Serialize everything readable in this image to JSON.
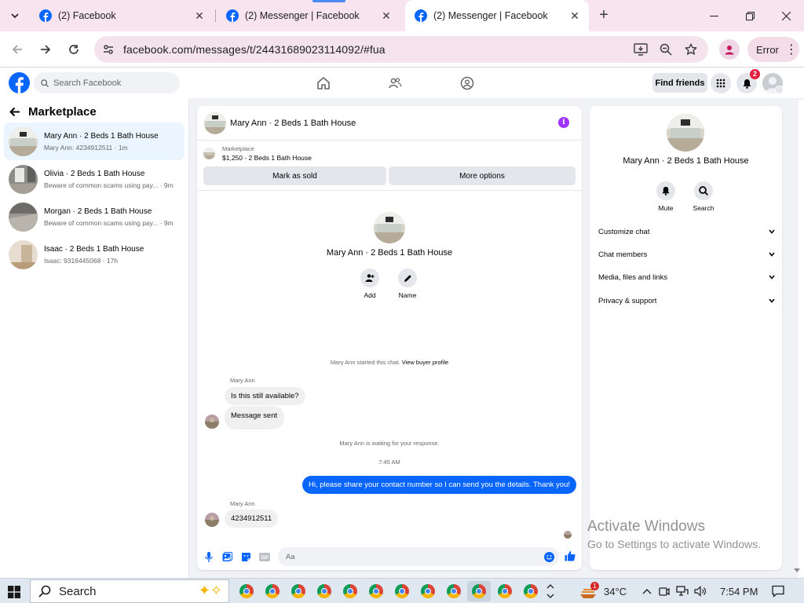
{
  "browser": {
    "tabs": [
      {
        "title": "(2) Facebook"
      },
      {
        "title": "(2) Messenger | Facebook"
      },
      {
        "title": "(2) Messenger | Facebook"
      }
    ],
    "url": "facebook.com/messages/t/24431689023114092/#fua",
    "profile_status": "Error"
  },
  "fb_header": {
    "search_placeholder": "Search Facebook",
    "find_friends": "Find friends",
    "notification_count": "2"
  },
  "sidebar": {
    "title": "Marketplace",
    "conversations": [
      {
        "name": "Mary Ann · 2 Beds 1 Bath House",
        "preview": "Mary Ann: 4234912511 · 1m"
      },
      {
        "name": "Olivia · 2 Beds 1 Bath House",
        "preview": "Beware of common scams using pay... · 9m"
      },
      {
        "name": "Morgan · 2 Beds 1 Bath House",
        "preview": "Beware of common scams using pay... · 9m"
      },
      {
        "name": "Isaac · 2 Beds 1 Bath House",
        "preview": "Isaac: 9316445068 · 17h"
      }
    ]
  },
  "chat": {
    "header_name": "Mary Ann · 2 Beds 1 Bath House",
    "marketplace_label": "Marketplace",
    "listing": "$1,250 - 2 Beds 1 Bath House",
    "mark_sold": "Mark as sold",
    "more_options": "More options",
    "profile_name": "Mary Ann · 2 Beds 1 Bath House",
    "add_label": "Add",
    "name_label": "Name",
    "started": "Mary Ann started this chat.",
    "view_profile": "View buyer profile",
    "sender1": "Mary Ann",
    "msg1": "Is this still available?",
    "msg2": "Message sent",
    "waiting": "Mary Ann is waiting for your response.",
    "time": "7:45 AM",
    "out_msg": "Hi, please share your contact number so I can send you the details. Thank you!",
    "sender2": "Mary Ann",
    "msg3": "4234912511",
    "composer_placeholder": "Aa"
  },
  "details": {
    "name": "Mary Ann · 2 Beds 1 Bath House",
    "mute": "Mute",
    "search": "Search",
    "rows": [
      "Customize chat",
      "Chat members",
      "Media, files and links",
      "Privacy & support"
    ]
  },
  "watermark": {
    "line1": "Activate Windows",
    "line2": "Go to Settings to activate Windows."
  },
  "taskbar": {
    "search": "Search",
    "weather_badge": "1",
    "temperature": "34°C",
    "clock": "7:54 PM"
  },
  "colors": {
    "facebook_blue": "#0866ff",
    "tabstrip": "#f8e4ef",
    "info_purple": "#a033ff"
  }
}
